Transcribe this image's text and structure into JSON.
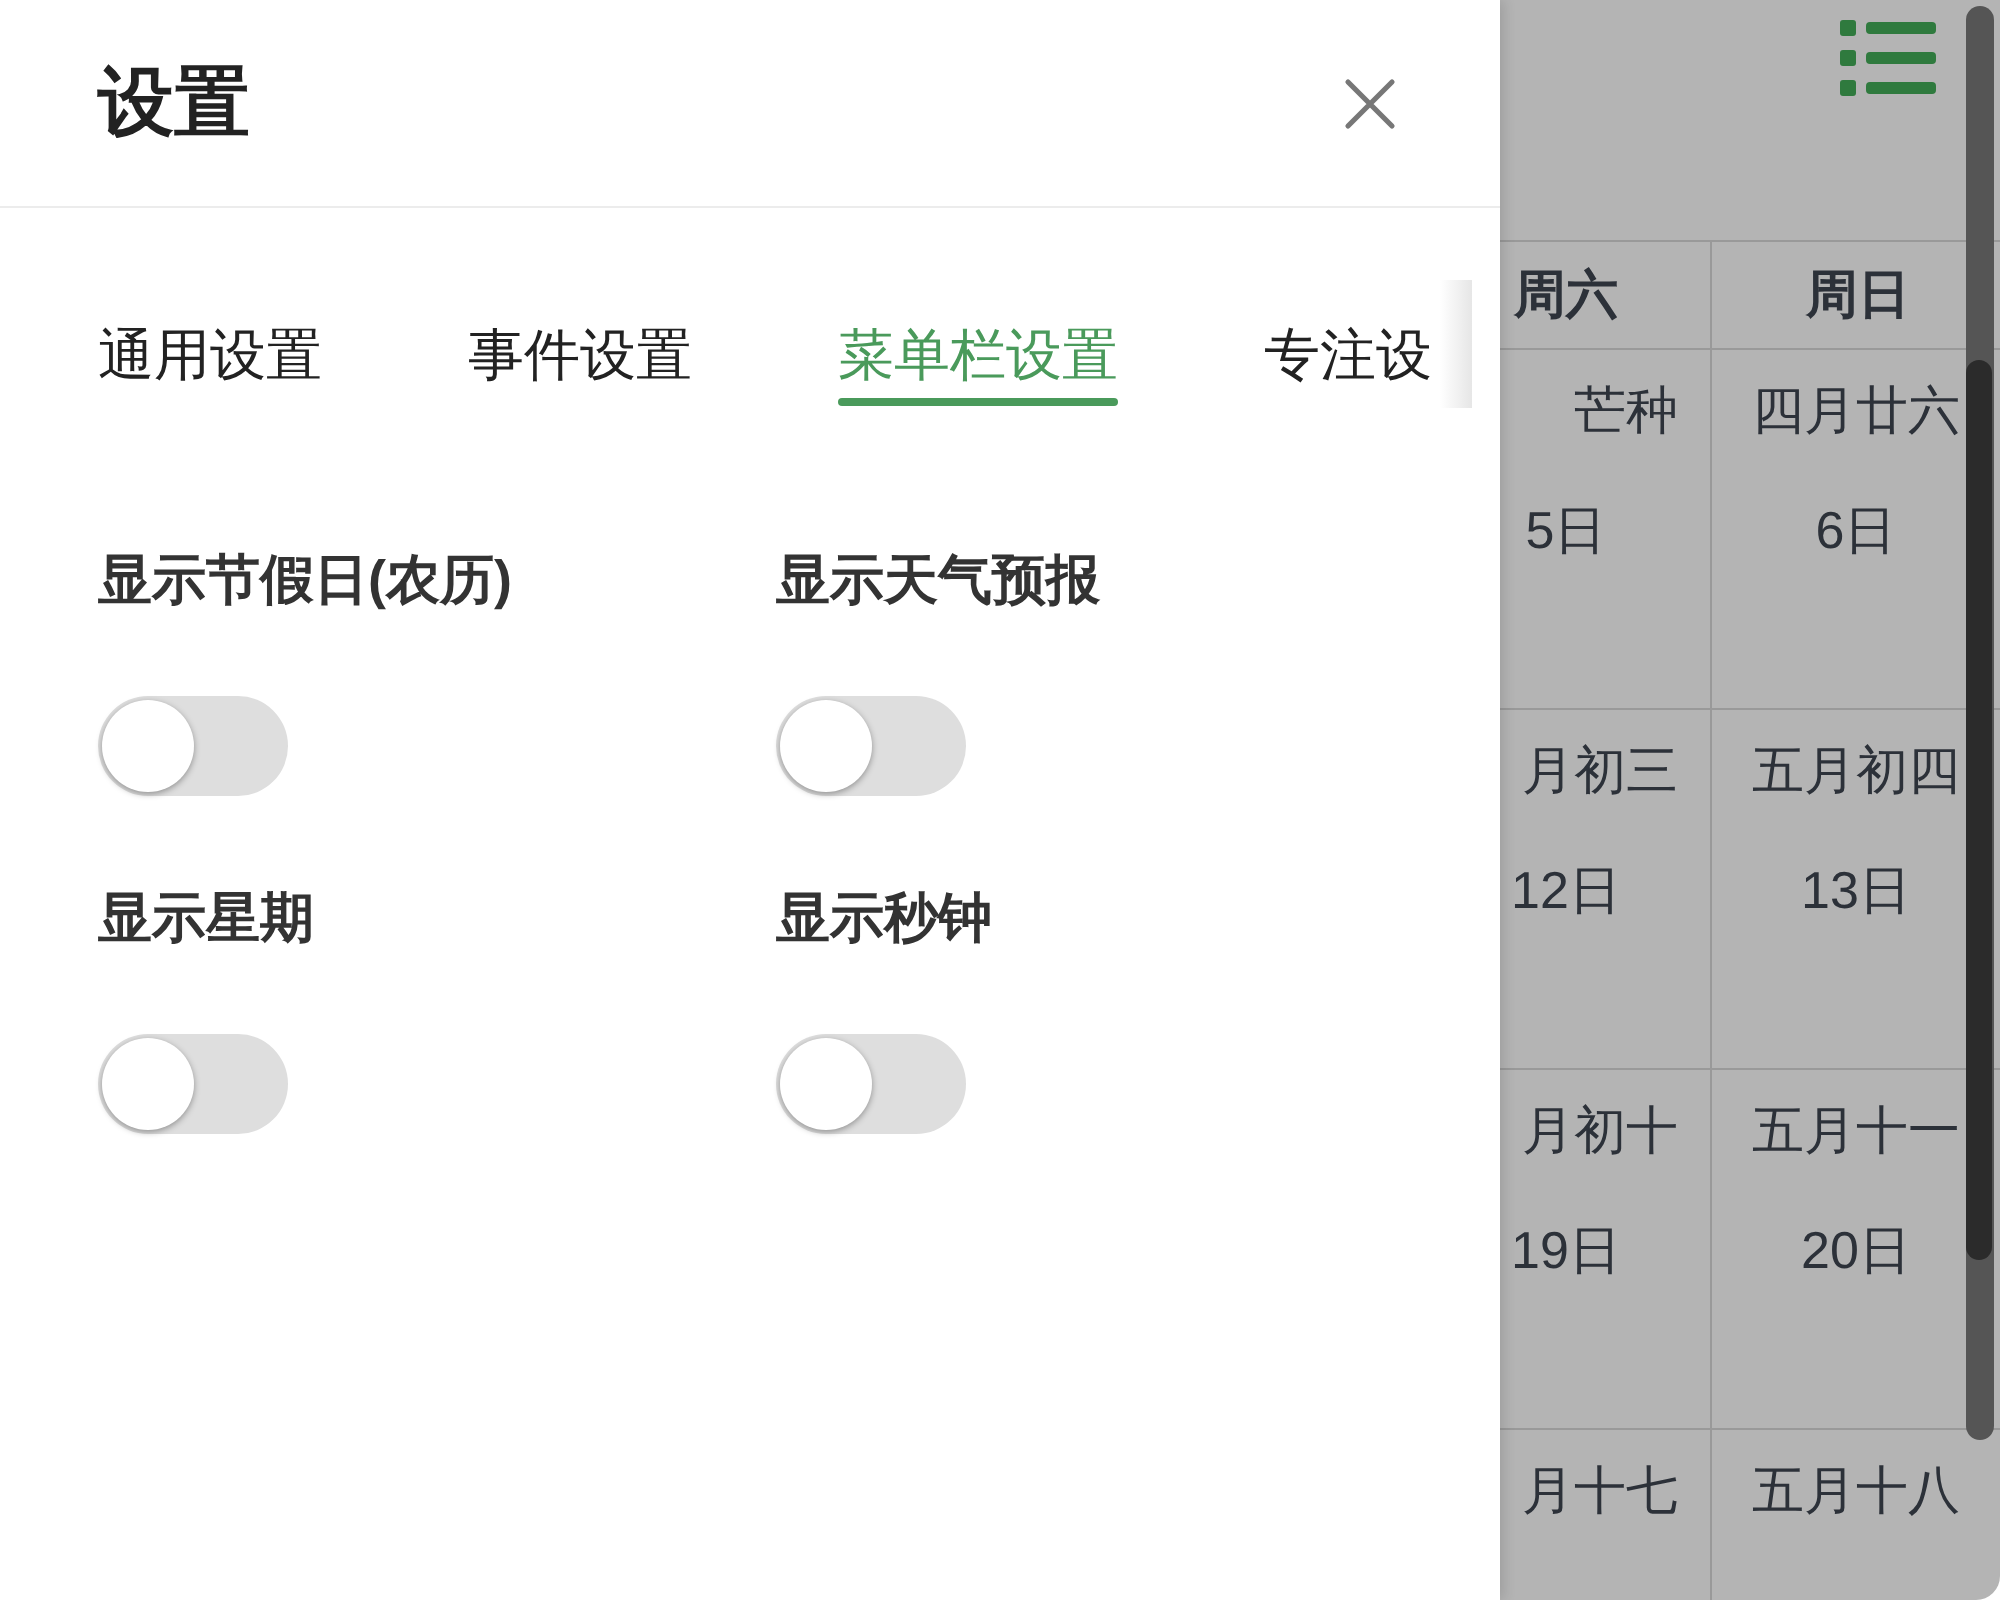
{
  "dialog": {
    "title": "设置"
  },
  "tabs": [
    {
      "label": "通用设置",
      "selected": false
    },
    {
      "label": "事件设置",
      "selected": false
    },
    {
      "label": "菜单栏设置",
      "selected": true
    },
    {
      "label": "专注设",
      "selected": false
    }
  ],
  "options": [
    {
      "label": "显示节假日(农历)",
      "on": false
    },
    {
      "label": "显示天气预报",
      "on": false
    },
    {
      "label": "显示星期",
      "on": false
    },
    {
      "label": "显示秒钟",
      "on": false
    }
  ],
  "calendar": {
    "columns": [
      "周六",
      "周日"
    ],
    "rows": [
      [
        {
          "lunar": "芒种",
          "date": "5日"
        },
        {
          "lunar": "四月廿六",
          "date": "6日"
        }
      ],
      [
        {
          "lunar": "月初三",
          "date": "12日"
        },
        {
          "lunar": "五月初四",
          "date": "13日"
        }
      ],
      [
        {
          "lunar": "月初十",
          "date": "19日"
        },
        {
          "lunar": "五月十一",
          "date": "20日"
        }
      ],
      [
        {
          "lunar": "月十七"
        },
        {
          "lunar": "五月十八"
        }
      ]
    ]
  }
}
